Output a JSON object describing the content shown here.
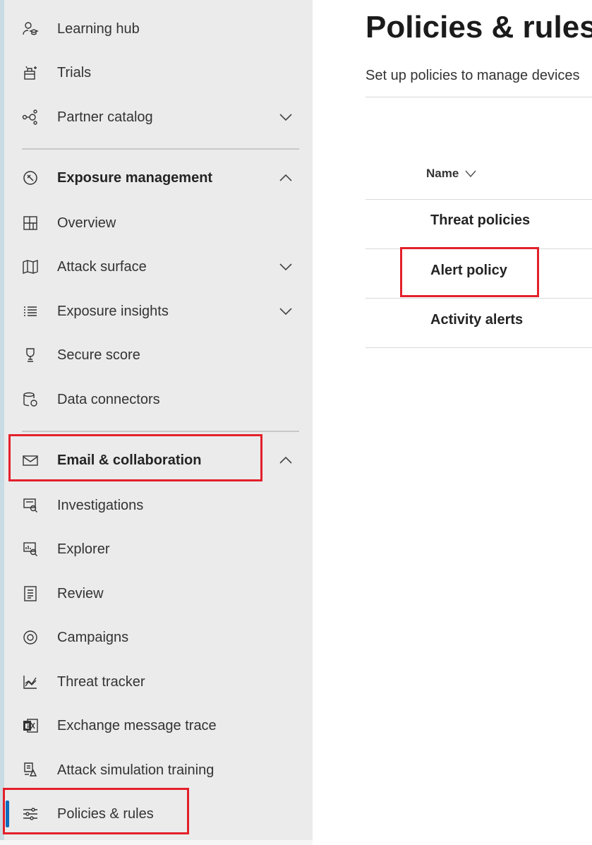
{
  "sidebar": {
    "items": [
      {
        "label": "Learning hub",
        "icon": "learning-hub-icon"
      },
      {
        "label": "Trials",
        "icon": "trials-icon"
      },
      {
        "label": "Partner catalog",
        "icon": "partner-catalog-icon"
      },
      {
        "label": "Exposure management",
        "icon": "exposure-management-icon"
      },
      {
        "label": "Overview",
        "icon": "overview-icon"
      },
      {
        "label": "Attack surface",
        "icon": "map-icon"
      },
      {
        "label": "Exposure insights",
        "icon": "list-icon"
      },
      {
        "label": "Secure score",
        "icon": "trophy-icon"
      },
      {
        "label": "Data connectors",
        "icon": "data-connectors-icon"
      },
      {
        "label": "Email & collaboration",
        "icon": "mail-icon"
      },
      {
        "label": "Investigations",
        "icon": "investigations-icon"
      },
      {
        "label": "Explorer",
        "icon": "explorer-icon"
      },
      {
        "label": "Review",
        "icon": "review-icon"
      },
      {
        "label": "Campaigns",
        "icon": "campaigns-icon"
      },
      {
        "label": "Threat tracker",
        "icon": "threat-tracker-icon"
      },
      {
        "label": "Exchange message trace",
        "icon": "exchange-icon"
      },
      {
        "label": "Attack simulation training",
        "icon": "attack-simulation-icon"
      },
      {
        "label": "Policies & rules",
        "icon": "sliders-icon"
      }
    ]
  },
  "main": {
    "title": "Policies & rules",
    "subtitle": "Set up policies to manage devices",
    "column_header": "Name",
    "rows": [
      "Threat policies",
      "Alert policy",
      "Activity alerts"
    ]
  },
  "colors": {
    "sidebar_bg": "#ebebeb",
    "accent": "#0f6cbd",
    "highlight": "#e3202b"
  }
}
